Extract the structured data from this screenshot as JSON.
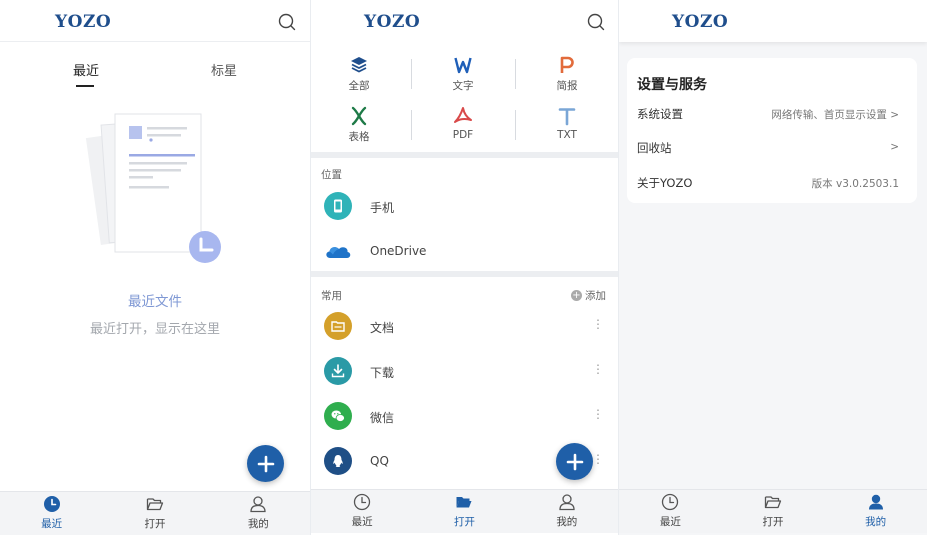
{
  "app": {
    "logo": "YOZO"
  },
  "nav": {
    "recent": "最近",
    "open": "打开",
    "mine": "我的"
  },
  "recent_screen": {
    "tabs": [
      "最近",
      "标星"
    ],
    "empty_title": "最近文件",
    "empty_subtitle": "最近打开，显示在这里"
  },
  "open_screen": {
    "file_types": [
      {
        "label": "全部",
        "icon": "layers-icon",
        "color": "#1f4e8c"
      },
      {
        "label": "文字",
        "icon": "word-icon",
        "color": "#1f5fb8"
      },
      {
        "label": "简报",
        "icon": "presentation-icon",
        "color": "#e26b3b"
      },
      {
        "label": "表格",
        "icon": "spreadsheet-icon",
        "color": "#1e7a47"
      },
      {
        "label": "PDF",
        "icon": "pdf-icon",
        "color": "#d94a4a"
      },
      {
        "label": "TXT",
        "icon": "txt-icon",
        "color": "#7aa6d6"
      }
    ],
    "location_title": "位置",
    "locations": [
      {
        "label": "手机",
        "icon": "phone-icon"
      },
      {
        "label": "OneDrive",
        "icon": "onedrive-icon"
      }
    ],
    "common_title": "常用",
    "add_label": "添加",
    "common": [
      {
        "label": "文档",
        "icon": "folder-icon",
        "more": "⋮"
      },
      {
        "label": "下载",
        "icon": "download-icon",
        "more": "⋮"
      },
      {
        "label": "微信",
        "icon": "wechat-icon",
        "more": "⋮"
      },
      {
        "label": "QQ",
        "icon": "qq-icon",
        "more": "⋮"
      }
    ]
  },
  "mine_screen": {
    "card_title": "设置与服务",
    "rows": [
      {
        "label": "系统设置",
        "value": "网络传输、首页显示设置  >"
      },
      {
        "label": "回收站",
        "value": ">"
      },
      {
        "label": "关于YOZO",
        "value": "版本 v3.0.2503.1"
      }
    ]
  },
  "colors": {
    "accent": "#1f5fa8",
    "logo": "#1f4e8c",
    "empty_title": "#7f98d4"
  }
}
